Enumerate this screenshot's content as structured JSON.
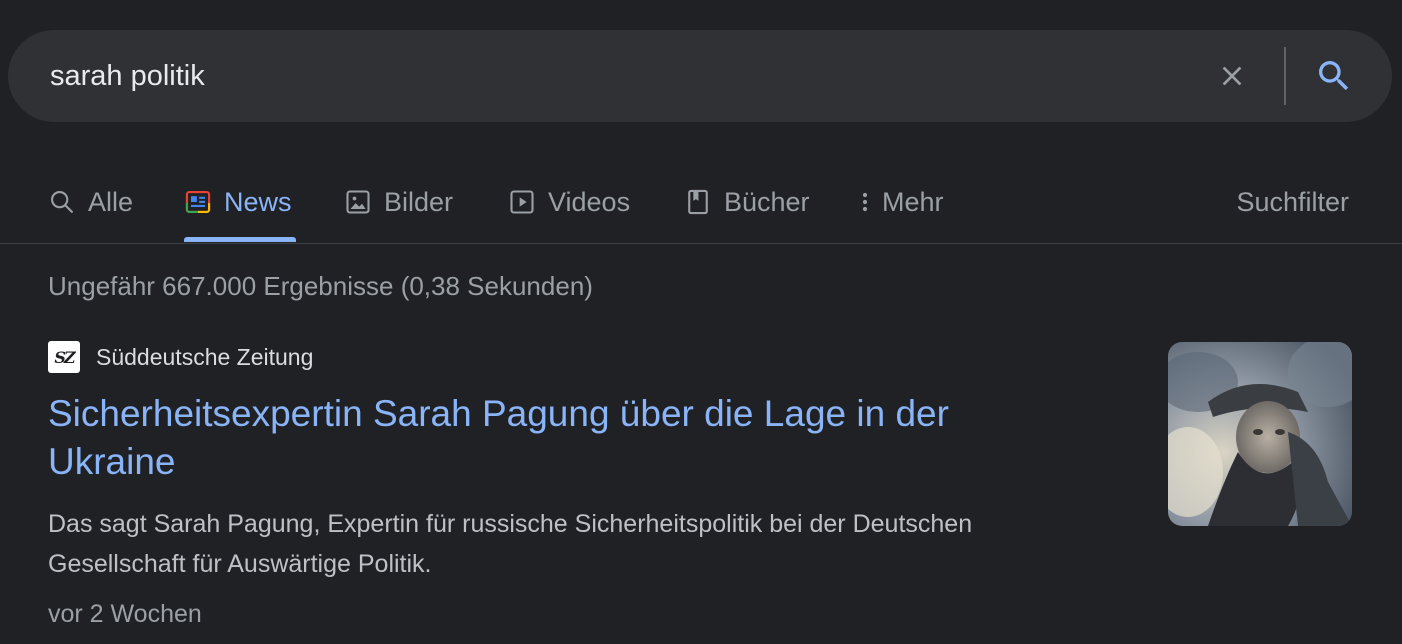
{
  "search": {
    "query": "sarah politik"
  },
  "tabs": [
    {
      "label": "Alle",
      "icon": "search-icon"
    },
    {
      "label": "News",
      "icon": "news-icon",
      "active": true
    },
    {
      "label": "Bilder",
      "icon": "image-icon"
    },
    {
      "label": "Videos",
      "icon": "video-icon"
    },
    {
      "label": "Bücher",
      "icon": "book-icon"
    },
    {
      "label": "Mehr",
      "icon": "more-vert-icon"
    }
  ],
  "suchfilter": "Suchfilter",
  "stats": "Ungefähr 667.000 Ergebnisse (0,38 Sekunden)",
  "result": {
    "source_logo": "SZ",
    "source": "Süddeutsche Zeitung",
    "title": "Sicherheitsexpertin Sarah Pagung über die Lage in der Ukraine",
    "snippet": "Das sagt Sarah Pagung, Expertin für russische Sicherheitspolitik bei der Deutschen Gesellschaft für Auswärtige Politik.",
    "date": "vor 2 Wochen"
  },
  "colors": {
    "background": "#202124",
    "searchbar": "#303134",
    "link": "#8ab4f8",
    "text_secondary": "#9aa0a6",
    "snippet": "#bdc1c6"
  }
}
